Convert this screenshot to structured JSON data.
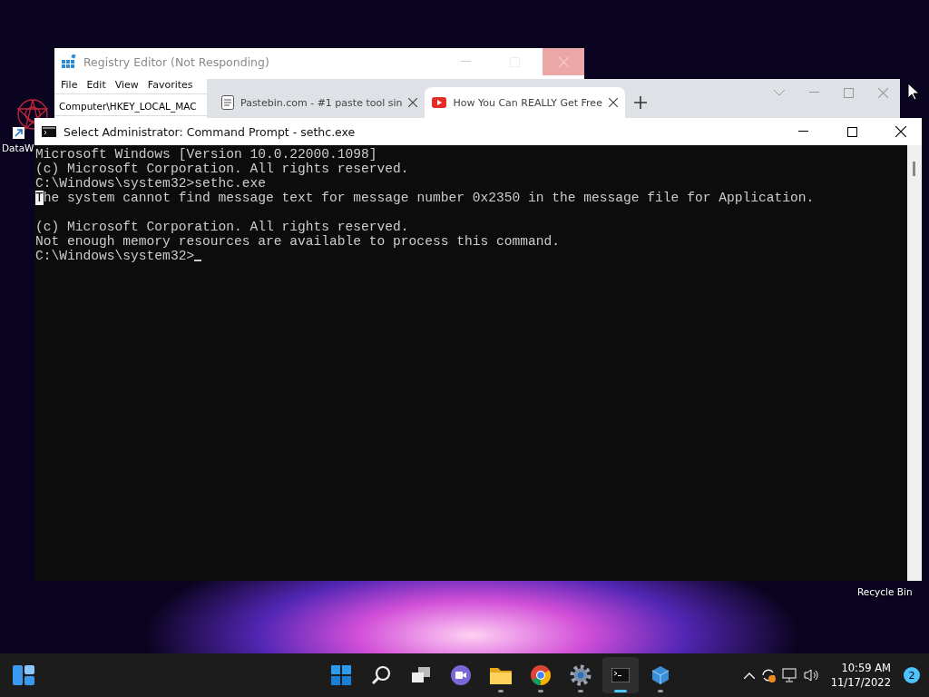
{
  "desktop": {
    "icons": [
      {
        "label": "DataW",
        "kind": "shortcut"
      },
      {
        "label": "Recycle Bin",
        "kind": "bin"
      }
    ]
  },
  "registry_window": {
    "title": "Registry Editor (Not Responding)",
    "menu": [
      "File",
      "Edit",
      "View",
      "Favorites"
    ],
    "address": "Computer\\HKEY_LOCAL_MAC"
  },
  "browser_window": {
    "tabs": [
      {
        "label": "Pastebin.com - #1 paste tool sin",
        "kind": "pastebin",
        "selected": false
      },
      {
        "label": "How You Can REALLY Get Free",
        "kind": "video",
        "selected": true
      }
    ]
  },
  "console_window": {
    "title": "Select Administrator: Command Prompt - sethc.exe",
    "lines": [
      {
        "kind": "text",
        "text": "Microsoft Windows [Version 10.0.22000.1098]",
        "marked": false
      },
      {
        "kind": "text",
        "text": "(c) Microsoft Corporation. All rights reserved.",
        "marked": false
      },
      {
        "kind": "text",
        "text": "C:\\Windows\\system32>sethc.exe",
        "marked": false
      },
      {
        "kind": "text",
        "text": "The system cannot find message text for message number 0x2350 in the message file for Application.",
        "marked": true
      },
      {
        "kind": "blank"
      },
      {
        "kind": "text",
        "text": "(c) Microsoft Corporation. All rights reserved.",
        "marked": false
      },
      {
        "kind": "text",
        "text": "Not enough memory resources are available to process this command.",
        "marked": false
      },
      {
        "kind": "prompt",
        "text": "C:\\Windows\\system32>"
      }
    ]
  },
  "taskbar": {
    "apps": [
      {
        "kind": "start",
        "running": false,
        "selected": false
      },
      {
        "kind": "search",
        "running": false,
        "selected": false
      },
      {
        "kind": "taskview",
        "running": false,
        "selected": false
      },
      {
        "kind": "chat",
        "running": false,
        "selected": false
      },
      {
        "kind": "files",
        "running": true,
        "selected": false
      },
      {
        "kind": "chrome",
        "running": true,
        "selected": false
      },
      {
        "kind": "settings",
        "running": true,
        "selected": false
      },
      {
        "kind": "terminal",
        "running": true,
        "selected": true
      },
      {
        "kind": "cube",
        "running": true,
        "selected": false
      }
    ],
    "time": "10:59 AM",
    "date": "11/17/2022",
    "notification_count": "2"
  }
}
